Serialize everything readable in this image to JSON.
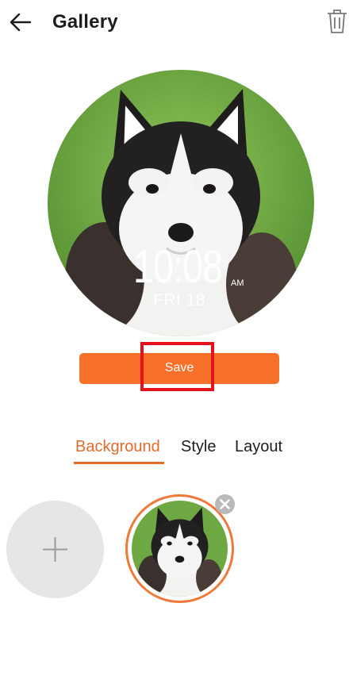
{
  "header": {
    "title": "Gallery",
    "back_icon": "arrow-left-icon",
    "delete_icon": "trash-icon"
  },
  "preview": {
    "time": "10:08",
    "ampm": "AM",
    "date": "FRI 18"
  },
  "actions": {
    "save_label": "Save"
  },
  "tabs": [
    {
      "label": "Background",
      "active": true
    },
    {
      "label": "Style",
      "active": false
    },
    {
      "label": "Layout",
      "active": false
    }
  ],
  "gallery": {
    "add_icon": "plus-icon",
    "remove_icon": "close-circle-icon"
  },
  "colors": {
    "accent": "#f6702a",
    "tab_active": "#e46a2b",
    "highlight": "#e5121b",
    "add_tile": "#e6e6e6"
  }
}
